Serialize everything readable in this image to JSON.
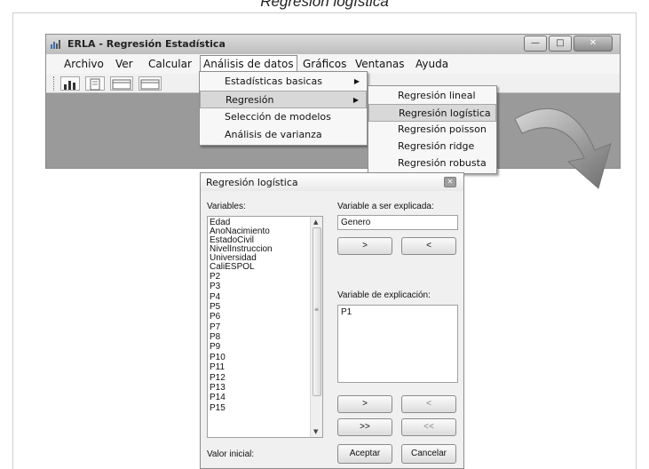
{
  "caption": "Regresión logística",
  "app": {
    "title": "ERLA - Regresión Estadística",
    "menu": [
      "Archivo",
      "Ver",
      "Calcular",
      "Análisis de datos",
      "Gráficos",
      "Ventanas",
      "Ayuda"
    ],
    "window_buttons": {
      "minimize": "—",
      "maximize": "□",
      "close": "✕"
    }
  },
  "menu_analisis": {
    "items": [
      "Estadísticas basicas",
      "Regresión",
      "Selección de modelos",
      "Análisis de varianza"
    ],
    "highlighted": "Regresión"
  },
  "menu_regresion": {
    "items": [
      "Regresión lineal",
      "Regresión logística",
      "Regresión poisson",
      "Regresión ridge",
      "Regresión robusta"
    ],
    "highlighted": "Regresión logística"
  },
  "dialog": {
    "title": "Regresión logística",
    "close_glyph": "✕",
    "variables_label": "Variables:",
    "variables": [
      "Edad",
      "AnoNacimiento",
      "EstadoCivil",
      "NivelInstruccion",
      "Universidad",
      "CaliESPOL",
      "P2",
      "P3",
      "P4",
      "P5",
      "P6",
      "P7",
      "P8",
      "P9",
      "P10",
      "P11",
      "P12",
      "P13",
      "P14",
      "P15"
    ],
    "dependent_label": "Variable a ser explicada:",
    "dependent_value": "Genero",
    "explanatory_label": "Variable de explicación:",
    "explanatory_values": [
      "P1"
    ],
    "btn_add": ">",
    "btn_remove": "<",
    "btn_add_all": ">>",
    "btn_remove_all": "<<",
    "initial_value_label": "Valor inicial:",
    "btn_accept": "Aceptar",
    "btn_cancel": "Cancelar"
  }
}
